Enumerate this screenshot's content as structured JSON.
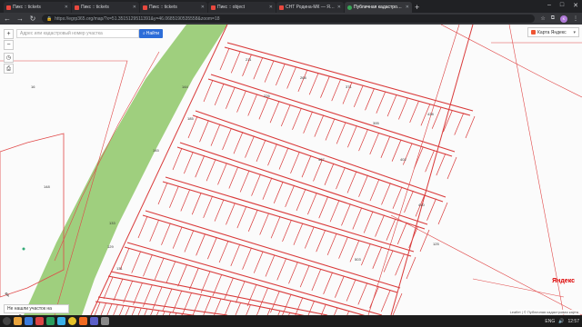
{
  "browser": {
    "tabs": [
      {
        "title": "Пикс :: tickets",
        "favicon": "red"
      },
      {
        "title": "Пикс :: tickets",
        "favicon": "red"
      },
      {
        "title": "Пикс :: tickets",
        "favicon": "red"
      },
      {
        "title": "Пикс :: object",
        "favicon": "red"
      },
      {
        "title": "СНТ Родина-МК — Янд...",
        "favicon": "red"
      },
      {
        "title": "Публичная кадастровая...",
        "favicon": "green",
        "active": true
      }
    ],
    "new_tab": "+",
    "url": "https://egrp365.org/map/?x=51.3515129511391&y=46.0685190535558&zoom=18"
  },
  "map": {
    "search_placeholder": "Адрес или кадастровый номер участка",
    "find_button": "Найти",
    "zoom_in": "+",
    "zoom_out": "−",
    "layer_select": "Карта Яндекс",
    "not_found": "Не нашли участок на карте?",
    "yandex_logo": "Яндекс",
    "copyright": "Leaflet | © Публичная кадастровая карта",
    "parcel_labels": [
      "16",
      "148",
      "144",
      "185",
      "133",
      "129",
      "131",
      "145",
      "211",
      "226",
      "268",
      "371",
      "395",
      "402",
      "410",
      "438",
      "467",
      "503",
      "125"
    ]
  },
  "taskbar": {
    "lang": "ENG",
    "time": "12:57"
  }
}
